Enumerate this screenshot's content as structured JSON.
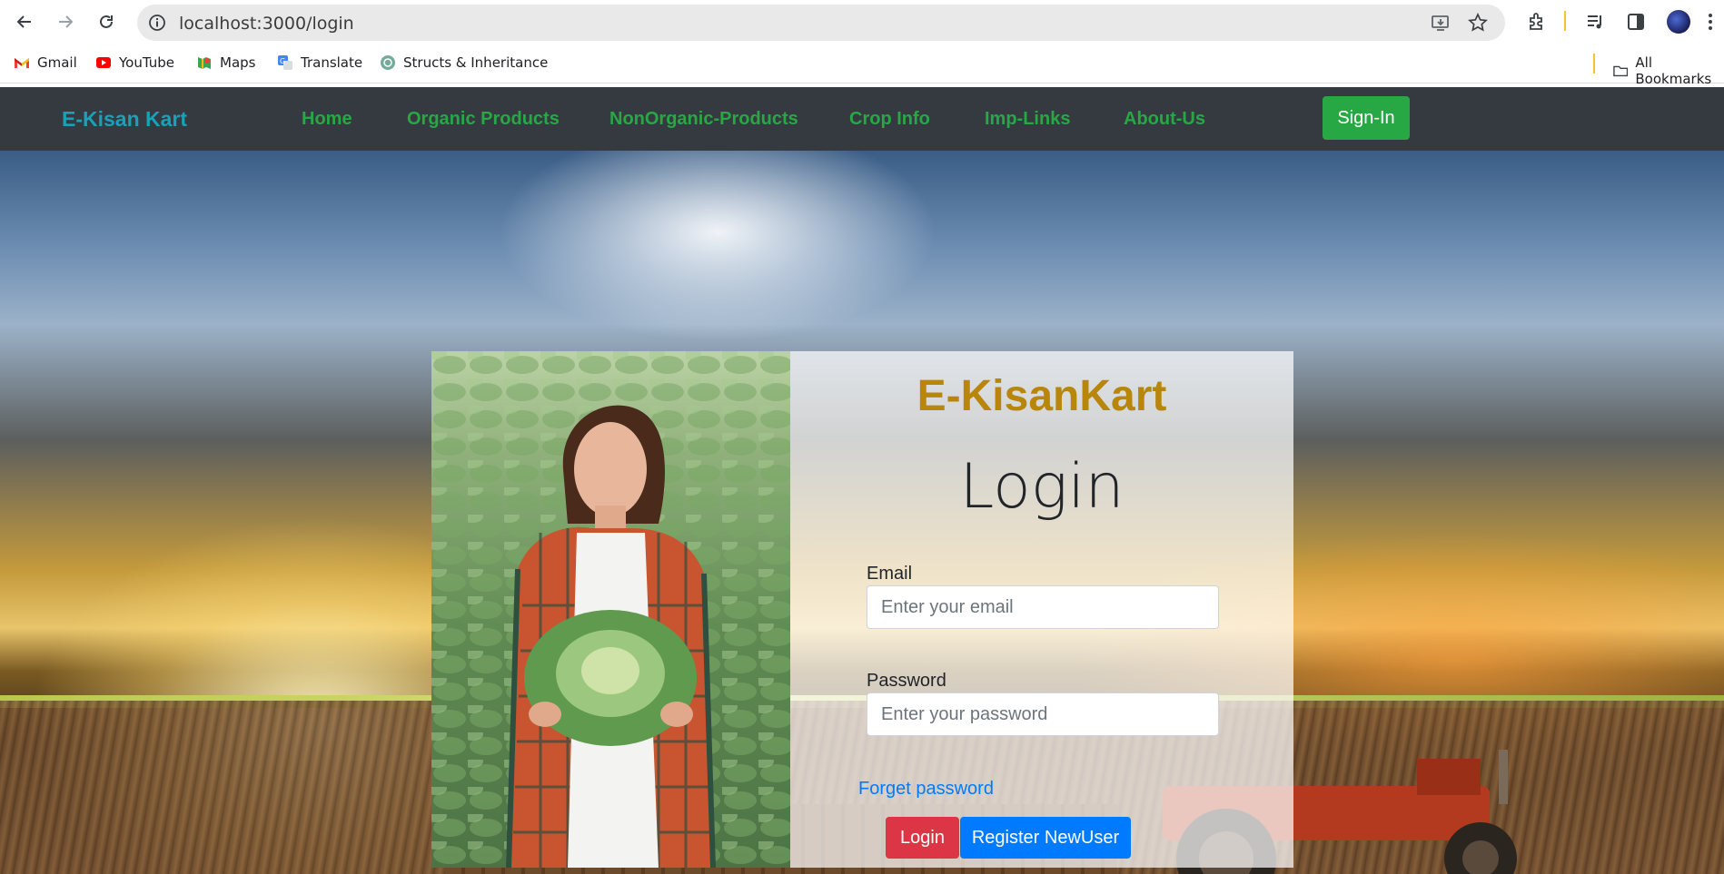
{
  "browser": {
    "url": "localhost:3000/login",
    "bookmarks": [
      {
        "label": "Gmail",
        "icon": "gmail-icon"
      },
      {
        "label": "YouTube",
        "icon": "youtube-icon"
      },
      {
        "label": "Maps",
        "icon": "maps-icon"
      },
      {
        "label": "Translate",
        "icon": "translate-icon"
      },
      {
        "label": "Structs & Inheritance",
        "icon": "chatgpt-icon"
      }
    ],
    "all_bookmarks_label": "All Bookmarks"
  },
  "navbar": {
    "brand": "E-Kisan Kart",
    "links": [
      "Home",
      "Organic Products",
      "NonOrganic-Products",
      "Crop Info",
      "Imp-Links",
      "About-Us"
    ],
    "signin_label": "Sign-In"
  },
  "login": {
    "brand": "E-KisanKart",
    "title": "Login",
    "email_label": "Email",
    "email_placeholder": "Enter your email",
    "password_label": "Password",
    "password_placeholder": "Enter your password",
    "forget_label": "Forget password",
    "login_button": "Login",
    "register_button": "Register NewUser"
  },
  "colors": {
    "navbar_bg": "#343a40",
    "brand": "#17a2b8",
    "nav_link": "#28a745",
    "signin": "#28a745",
    "card_brand": "#b8860b",
    "login_button": "#dc3545",
    "register_button": "#007bff",
    "link": "#007bff"
  }
}
